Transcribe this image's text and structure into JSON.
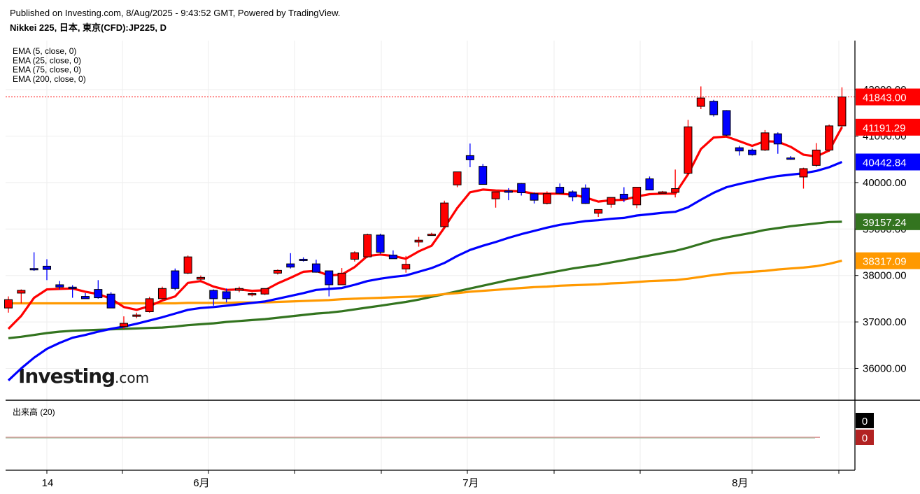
{
  "header": {
    "published": "Published on Investing.com, 8/Aug/2025 - 9:43:52 GMT, Powered by TradingView.",
    "symbol": "Nikkei 225, 日本, 東京(CFD):JP225, D"
  },
  "logo": {
    "main": "Investing",
    "domain": ".com"
  },
  "indicators": [
    {
      "label": "EMA (5, close, 0)",
      "color": "#ff0000",
      "last": 41191.29,
      "tag": "41191.29"
    },
    {
      "label": "EMA (25, close, 0)",
      "color": "#0000ff",
      "last": 40442.84,
      "tag": "40442.84"
    },
    {
      "label": "EMA (75, close, 0)",
      "color": "#ff9900",
      "last": 38317.09,
      "tag": "38317.09"
    },
    {
      "label": "EMA (200, close, 0)",
      "color": "#33741f",
      "last": 39157.24,
      "tag": "39157.24"
    }
  ],
  "last_price": {
    "value": 41843,
    "tag": "41843.00",
    "color": "#ff0000"
  },
  "volume": {
    "label": "出来高 (20)",
    "value_tag": "0",
    "ma_tag": "0"
  },
  "colors": {
    "up": "#ff0000",
    "down": "#0000ff",
    "wick": "#000000",
    "grid": "#eeeeee"
  },
  "chart_data": {
    "type": "candlestick",
    "y_ticks": [
      "36000.00",
      "37000.00",
      "38000.00",
      "39000.00",
      "40000.00",
      "41000.00",
      "42000.00"
    ],
    "ylim": [
      35450,
      42800
    ],
    "x_labels": [
      {
        "text": "14",
        "index": 3
      },
      {
        "text": "6月",
        "index": 15
      },
      {
        "text": "7月",
        "index": 36
      },
      {
        "text": "8月",
        "index": 57
      }
    ],
    "grid": true,
    "candles": [
      {
        "o": 37300,
        "h": 37550,
        "l": 37200,
        "c": 37480
      },
      {
        "o": 37620,
        "h": 37700,
        "l": 37400,
        "c": 37680
      },
      {
        "o": 38150,
        "h": 38500,
        "l": 38100,
        "c": 38130
      },
      {
        "o": 38200,
        "h": 38350,
        "l": 37900,
        "c": 38130
      },
      {
        "o": 37800,
        "h": 37880,
        "l": 37700,
        "c": 37750
      },
      {
        "o": 37750,
        "h": 37790,
        "l": 37520,
        "c": 37740
      },
      {
        "o": 37550,
        "h": 37620,
        "l": 37500,
        "c": 37500
      },
      {
        "o": 37700,
        "h": 37900,
        "l": 37500,
        "c": 37520
      },
      {
        "o": 37600,
        "h": 37640,
        "l": 37300,
        "c": 37300
      },
      {
        "o": 36900,
        "h": 37120,
        "l": 36850,
        "c": 36970
      },
      {
        "o": 37130,
        "h": 37200,
        "l": 37080,
        "c": 37150
      },
      {
        "o": 37220,
        "h": 37540,
        "l": 37200,
        "c": 37500
      },
      {
        "o": 37500,
        "h": 37760,
        "l": 37450,
        "c": 37720
      },
      {
        "o": 38100,
        "h": 38150,
        "l": 37680,
        "c": 37720
      },
      {
        "o": 38050,
        "h": 38430,
        "l": 38030,
        "c": 38400
      },
      {
        "o": 37920,
        "h": 38000,
        "l": 37850,
        "c": 37960
      },
      {
        "o": 37680,
        "h": 37700,
        "l": 37350,
        "c": 37500
      },
      {
        "o": 37650,
        "h": 37720,
        "l": 37420,
        "c": 37500
      },
      {
        "o": 37680,
        "h": 37760,
        "l": 37640,
        "c": 37720
      },
      {
        "o": 37580,
        "h": 37630,
        "l": 37550,
        "c": 37610
      },
      {
        "o": 37600,
        "h": 37720,
        "l": 37580,
        "c": 37720
      },
      {
        "o": 38050,
        "h": 38130,
        "l": 38020,
        "c": 38110
      },
      {
        "o": 38250,
        "h": 38480,
        "l": 38150,
        "c": 38180
      },
      {
        "o": 38350,
        "h": 38390,
        "l": 38300,
        "c": 38330
      },
      {
        "o": 38250,
        "h": 38340,
        "l": 38060,
        "c": 38070
      },
      {
        "o": 38100,
        "h": 38100,
        "l": 37550,
        "c": 37800
      },
      {
        "o": 37800,
        "h": 38160,
        "l": 37800,
        "c": 38050
      },
      {
        "o": 38350,
        "h": 38520,
        "l": 38300,
        "c": 38490
      },
      {
        "o": 38400,
        "h": 38900,
        "l": 38380,
        "c": 38880
      },
      {
        "o": 38870,
        "h": 38900,
        "l": 38460,
        "c": 38500
      },
      {
        "o": 38440,
        "h": 38540,
        "l": 38360,
        "c": 38360
      },
      {
        "o": 38140,
        "h": 38420,
        "l": 38060,
        "c": 38240
      },
      {
        "o": 38720,
        "h": 38830,
        "l": 38620,
        "c": 38760
      },
      {
        "o": 38870,
        "h": 38920,
        "l": 38860,
        "c": 38890
      },
      {
        "o": 39050,
        "h": 39610,
        "l": 39020,
        "c": 39560
      },
      {
        "o": 39950,
        "h": 40200,
        "l": 39900,
        "c": 40230
      },
      {
        "o": 40580,
        "h": 40840,
        "l": 40330,
        "c": 40490
      },
      {
        "o": 40350,
        "h": 40400,
        "l": 39960,
        "c": 39960
      },
      {
        "o": 39650,
        "h": 39800,
        "l": 39460,
        "c": 39800
      },
      {
        "o": 39820,
        "h": 39880,
        "l": 39620,
        "c": 39800
      },
      {
        "o": 39980,
        "h": 39990,
        "l": 39720,
        "c": 39780
      },
      {
        "o": 39760,
        "h": 39790,
        "l": 39550,
        "c": 39620
      },
      {
        "o": 39550,
        "h": 39810,
        "l": 39530,
        "c": 39760
      },
      {
        "o": 39900,
        "h": 39980,
        "l": 39750,
        "c": 39770
      },
      {
        "o": 39800,
        "h": 39830,
        "l": 39600,
        "c": 39690
      },
      {
        "o": 39880,
        "h": 39960,
        "l": 39540,
        "c": 39550
      },
      {
        "o": 39340,
        "h": 39390,
        "l": 39260,
        "c": 39420
      },
      {
        "o": 39530,
        "h": 39670,
        "l": 39460,
        "c": 39680
      },
      {
        "o": 39750,
        "h": 39900,
        "l": 39580,
        "c": 39650
      },
      {
        "o": 39520,
        "h": 39900,
        "l": 39450,
        "c": 39900
      },
      {
        "o": 40080,
        "h": 40130,
        "l": 39870,
        "c": 39840
      },
      {
        "o": 39780,
        "h": 39820,
        "l": 39750,
        "c": 39800
      },
      {
        "o": 39790,
        "h": 40280,
        "l": 39680,
        "c": 39870
      },
      {
        "o": 40200,
        "h": 41350,
        "l": 40150,
        "c": 41200
      },
      {
        "o": 41640,
        "h": 42070,
        "l": 41580,
        "c": 41820
      },
      {
        "o": 41750,
        "h": 41780,
        "l": 41420,
        "c": 41460
      },
      {
        "o": 41550,
        "h": 41560,
        "l": 41000,
        "c": 41020
      },
      {
        "o": 40750,
        "h": 40790,
        "l": 40580,
        "c": 40680
      },
      {
        "o": 40700,
        "h": 40730,
        "l": 40580,
        "c": 40600
      },
      {
        "o": 40700,
        "h": 41130,
        "l": 40680,
        "c": 41070
      },
      {
        "o": 41050,
        "h": 41080,
        "l": 40620,
        "c": 40830
      },
      {
        "o": 40530,
        "h": 40570,
        "l": 40490,
        "c": 40520
      },
      {
        "o": 40120,
        "h": 40320,
        "l": 39870,
        "c": 40300
      },
      {
        "o": 40370,
        "h": 40850,
        "l": 40340,
        "c": 40700
      },
      {
        "o": 40700,
        "h": 41250,
        "l": 40660,
        "c": 41220
      },
      {
        "o": 41220,
        "h": 42050,
        "l": 41170,
        "c": 41843
      }
    ],
    "ema5": [
      36850,
      37130,
      37520,
      37700,
      37710,
      37720,
      37650,
      37600,
      37500,
      37320,
      37260,
      37340,
      37460,
      37550,
      37840,
      37880,
      37760,
      37690,
      37700,
      37670,
      37680,
      37830,
      37950,
      38080,
      38100,
      38000,
      38020,
      38180,
      38420,
      38450,
      38420,
      38360,
      38520,
      38640,
      39030,
      39450,
      39790,
      39850,
      39830,
      39820,
      39810,
      39760,
      39760,
      39760,
      39740,
      39680,
      39590,
      39620,
      39630,
      39700,
      39750,
      39760,
      39760,
      40180,
      40720,
      40970,
      40990,
      40890,
      40790,
      40890,
      40880,
      40770,
      40600,
      40560,
      40690,
      41191.29
    ],
    "ema25": [
      35740,
      36000,
      36230,
      36420,
      36550,
      36660,
      36720,
      36790,
      36850,
      36900,
      36960,
      37030,
      37100,
      37180,
      37260,
      37300,
      37320,
      37350,
      37380,
      37410,
      37440,
      37500,
      37560,
      37620,
      37690,
      37710,
      37730,
      37800,
      37880,
      37930,
      37970,
      38000,
      38080,
      38160,
      38270,
      38420,
      38550,
      38640,
      38720,
      38810,
      38890,
      38960,
      39030,
      39090,
      39130,
      39170,
      39190,
      39220,
      39240,
      39290,
      39320,
      39350,
      39370,
      39470,
      39630,
      39780,
      39900,
      39970,
      40030,
      40090,
      40140,
      40170,
      40200,
      40250,
      40330,
      40442.84
    ],
    "ema75": [
      37400,
      37400,
      37400,
      37400,
      37400,
      37400,
      37400,
      37400,
      37400,
      37400,
      37400,
      37400,
      37400,
      37400,
      37410,
      37410,
      37410,
      37410,
      37420,
      37420,
      37420,
      37430,
      37440,
      37450,
      37460,
      37470,
      37490,
      37500,
      37510,
      37520,
      37530,
      37540,
      37550,
      37570,
      37600,
      37620,
      37650,
      37670,
      37690,
      37710,
      37730,
      37750,
      37760,
      37780,
      37790,
      37800,
      37810,
      37830,
      37840,
      37860,
      37880,
      37890,
      37900,
      37930,
      37970,
      38010,
      38040,
      38060,
      38080,
      38100,
      38130,
      38150,
      38170,
      38200,
      38250,
      38317.09
    ],
    "ema200": [
      36650,
      36680,
      36720,
      36760,
      36790,
      36810,
      36820,
      36830,
      36840,
      36850,
      36860,
      36870,
      36880,
      36900,
      36930,
      36950,
      36970,
      37000,
      37020,
      37040,
      37060,
      37090,
      37120,
      37150,
      37180,
      37200,
      37230,
      37270,
      37310,
      37350,
      37390,
      37430,
      37480,
      37540,
      37600,
      37660,
      37720,
      37780,
      37840,
      37900,
      37950,
      38000,
      38050,
      38100,
      38150,
      38190,
      38230,
      38280,
      38330,
      38380,
      38430,
      38480,
      38530,
      38600,
      38680,
      38760,
      38820,
      38870,
      38920,
      38980,
      39020,
      39060,
      39090,
      39120,
      39150,
      39157.24
    ]
  }
}
